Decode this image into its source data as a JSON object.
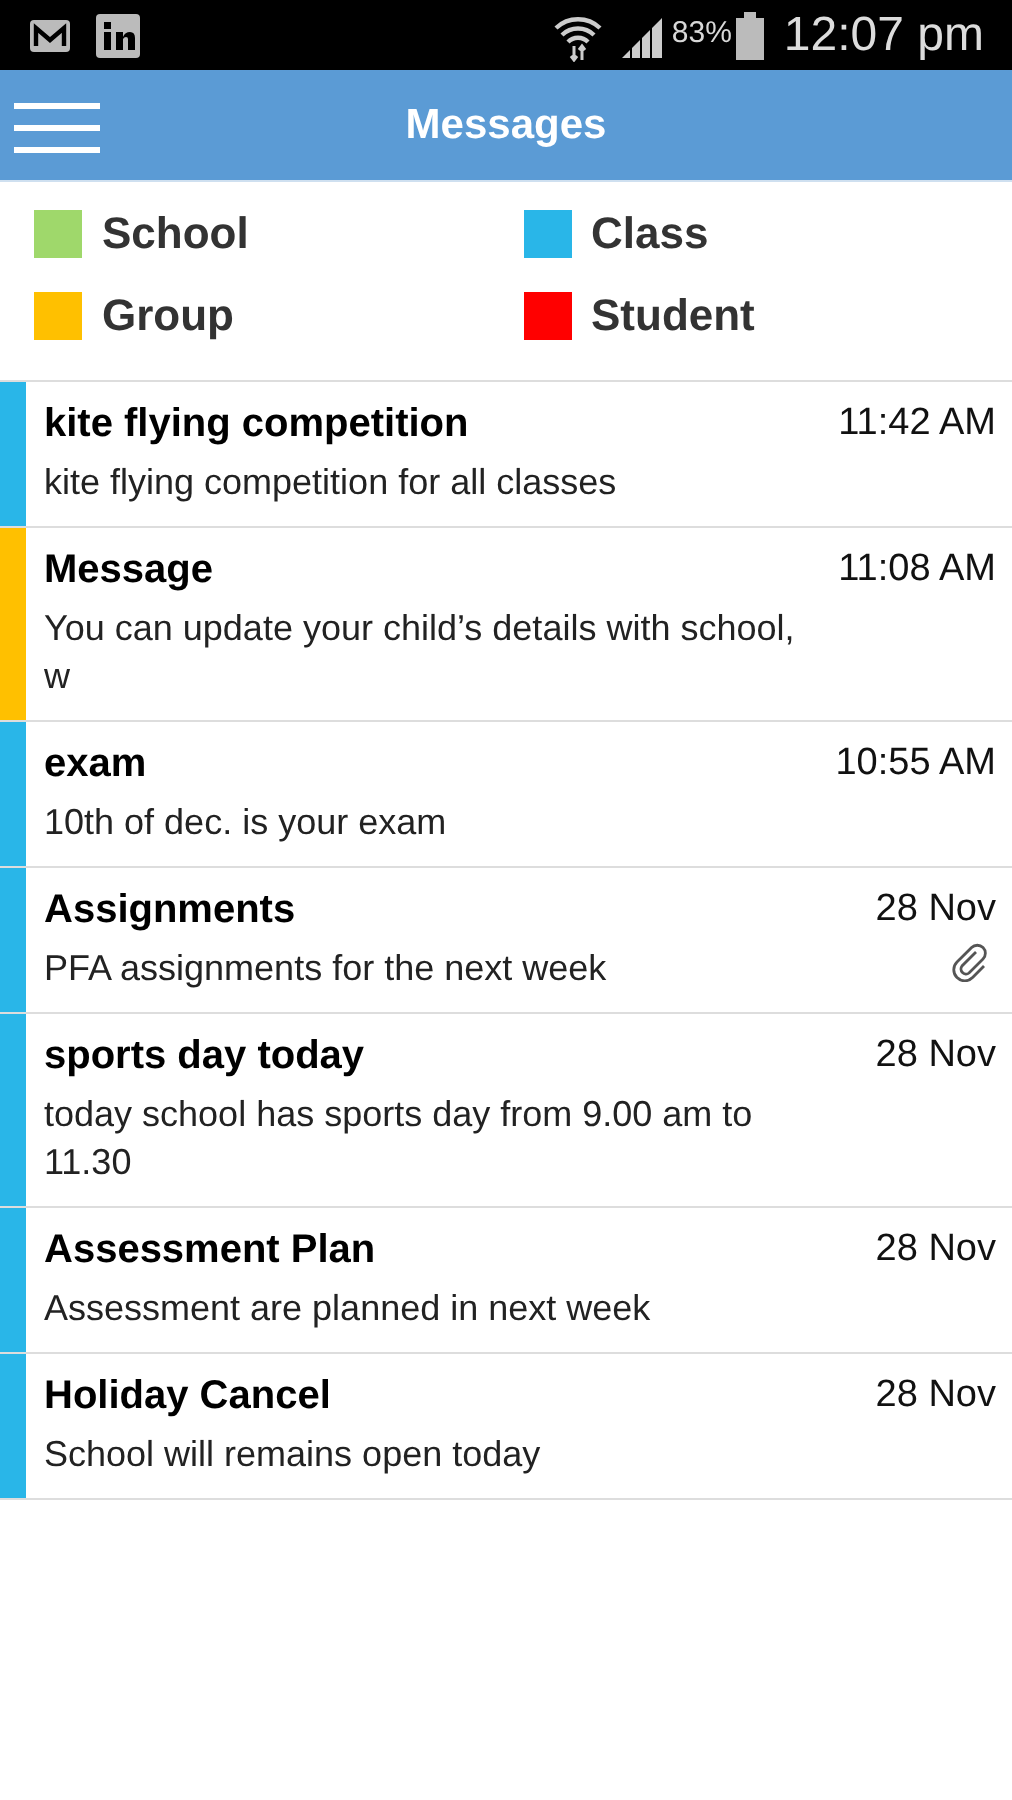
{
  "status_bar": {
    "battery": "83%",
    "time": "12:07 pm"
  },
  "app_bar": {
    "title": "Messages"
  },
  "legend": [
    {
      "label": "School",
      "color": "#9fd86b"
    },
    {
      "label": "Class",
      "color": "#29b6e8"
    },
    {
      "label": "Group",
      "color": "#ffc000"
    },
    {
      "label": "Student",
      "color": "#ff0000"
    }
  ],
  "messages": [
    {
      "title": "kite flying competition",
      "time": "11:42 AM",
      "body": "kite flying competition for all classes",
      "color": "#29b6e8",
      "attachment": false
    },
    {
      "title": "Message",
      "time": "11:08 AM",
      "body": "You can update your child’s details with school, w",
      "color": "#ffc000",
      "attachment": false
    },
    {
      "title": "exam",
      "time": "10:55 AM",
      "body": "10th of dec. is your exam",
      "color": "#29b6e8",
      "attachment": false
    },
    {
      "title": "Assignments",
      "time": "28 Nov",
      "body": "PFA assignments for the next week",
      "color": "#29b6e8",
      "attachment": true
    },
    {
      "title": "sports day today",
      "time": "28 Nov",
      "body": "today school has sports day from 9.00 am to 11.30",
      "color": "#29b6e8",
      "attachment": false
    },
    {
      "title": "Assessment Plan",
      "time": "28 Nov",
      "body": "Assessment are planned in next week",
      "color": "#29b6e8",
      "attachment": false
    },
    {
      "title": "Holiday Cancel",
      "time": "28 Nov",
      "body": "School will remains open today",
      "color": "#29b6e8",
      "attachment": false
    }
  ]
}
